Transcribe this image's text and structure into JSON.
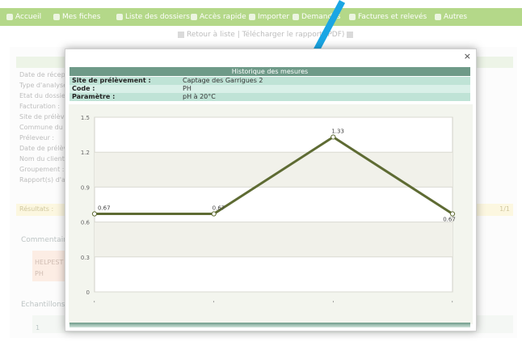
{
  "nav": {
    "items": [
      {
        "label": "Accueil",
        "icon": "home-icon"
      },
      {
        "label": "Mes fiches",
        "icon": "clients-icon"
      },
      {
        "label": "Liste des dossiers",
        "icon": "folders-icon"
      },
      {
        "label": "Accès rapide",
        "icon": "fast-access-icon"
      },
      {
        "label": "Importer",
        "icon": "import-icon"
      },
      {
        "label": "Demandes",
        "icon": "requests-icon"
      },
      {
        "label": "Factures et relevés",
        "icon": "invoices-icon"
      },
      {
        "label": "Autres",
        "icon": "other-icon"
      }
    ]
  },
  "subbar": {
    "back": "Retour à liste",
    "sep": "|",
    "download": "Télécharger le rapport (PDF)"
  },
  "background": {
    "labels": [
      "Date de réception :",
      "Type d'analyse :",
      "Etat du dossier :",
      "Facturation :",
      "Site de prélèvement :",
      "Commune du site :",
      "Préleveur :",
      "Date de prélèvement :",
      "Nom du client :",
      "Groupement :",
      "Rapport(s) d'analyse :"
    ],
    "yellow_label": "Résultats :",
    "yellow_count": "1/1",
    "section1": "Commentaires",
    "table_cells": [
      "HELPEST",
      "PH"
    ],
    "section2": "Echantillons",
    "row_index": "1"
  },
  "modal": {
    "close": "×",
    "title": "Historique des mesures",
    "info": [
      {
        "key": "Site de prélèvement :",
        "value": "Captage des Garrigues 2"
      },
      {
        "key": "Code :",
        "value": "PH"
      },
      {
        "key": "Paramètre :",
        "value": "pH à 20°C"
      }
    ]
  },
  "chart_data": {
    "type": "line",
    "x": [
      "-",
      "-",
      "-",
      "-"
    ],
    "values": [
      0.67,
      0.67,
      1.33,
      0.67
    ],
    "data_labels": [
      "0.67",
      "0.67",
      "1.33",
      "0.67"
    ],
    "y_ticks": [
      "0",
      "0.3",
      "0.6",
      "0.9",
      "1.2",
      "1.5"
    ],
    "ylim": [
      0,
      1.5
    ],
    "grid": true,
    "line_color": "#5e6b33"
  }
}
